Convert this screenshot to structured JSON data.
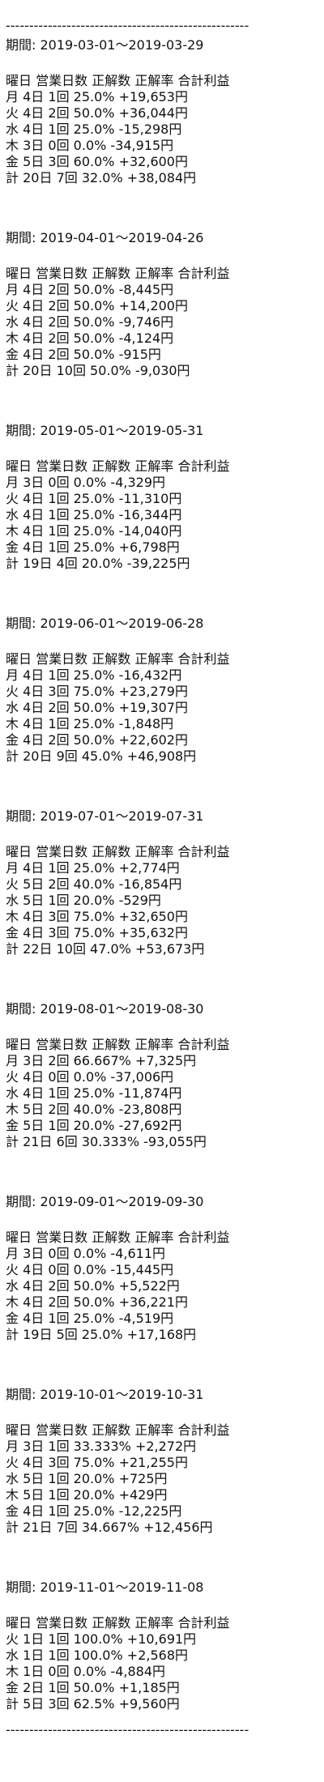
{
  "divider": "----------------------------------------------------",
  "period_label": "期間: ",
  "header": [
    "曜日",
    "営業日数",
    "正解数",
    "正解率",
    "合計利益"
  ],
  "periods": [
    {
      "range": "2019-03-01〜2019-03-29",
      "rows": [
        [
          "月",
          "4日",
          "1回",
          "25.0%",
          "+19,653円"
        ],
        [
          "火",
          "4日",
          "2回",
          "50.0%",
          "+36,044円"
        ],
        [
          "水",
          "4日",
          "1回",
          "25.0%",
          "-15,298円"
        ],
        [
          "木",
          "3日",
          "0回",
          "0.0%",
          "-34,915円"
        ],
        [
          "金",
          "5日",
          "3回",
          "60.0%",
          "+32,600円"
        ],
        [
          "計",
          "20日",
          "7回",
          "32.0%",
          "+38,084円"
        ]
      ]
    },
    {
      "range": "2019-04-01〜2019-04-26",
      "rows": [
        [
          "月",
          "4日",
          "2回",
          "50.0%",
          "-8,445円"
        ],
        [
          "火",
          "4日",
          "2回",
          "50.0%",
          "+14,200円"
        ],
        [
          "水",
          "4日",
          "2回",
          "50.0%",
          "-9,746円"
        ],
        [
          "木",
          "4日",
          "2回",
          "50.0%",
          "-4,124円"
        ],
        [
          "金",
          "4日",
          "2回",
          "50.0%",
          "-915円"
        ],
        [
          "計",
          "20日",
          "10回",
          "50.0%",
          "-9,030円"
        ]
      ]
    },
    {
      "range": "2019-05-01〜2019-05-31",
      "rows": [
        [
          "月",
          "3日",
          "0回",
          "0.0%",
          "-4,329円"
        ],
        [
          "火",
          "4日",
          "1回",
          "25.0%",
          "-11,310円"
        ],
        [
          "水",
          "4日",
          "1回",
          "25.0%",
          "-16,344円"
        ],
        [
          "木",
          "4日",
          "1回",
          "25.0%",
          "-14,040円"
        ],
        [
          "金",
          "4日",
          "1回",
          "25.0%",
          "+6,798円"
        ],
        [
          "計",
          "19日",
          "4回",
          "20.0%",
          "-39,225円"
        ]
      ]
    },
    {
      "range": "2019-06-01〜2019-06-28",
      "rows": [
        [
          "月",
          "4日",
          "1回",
          "25.0%",
          "-16,432円"
        ],
        [
          "火",
          "4日",
          "3回",
          "75.0%",
          "+23,279円"
        ],
        [
          "水",
          "4日",
          "2回",
          "50.0%",
          "+19,307円"
        ],
        [
          "木",
          "4日",
          "1回",
          "25.0%",
          "-1,848円"
        ],
        [
          "金",
          "4日",
          "2回",
          "50.0%",
          "+22,602円"
        ],
        [
          "計",
          "20日",
          "9回",
          "45.0%",
          "+46,908円"
        ]
      ]
    },
    {
      "range": "2019-07-01〜2019-07-31",
      "rows": [
        [
          "月",
          "4日",
          "1回",
          "25.0%",
          "+2,774円"
        ],
        [
          "火",
          "5日",
          "2回",
          "40.0%",
          "-16,854円"
        ],
        [
          "水",
          "5日",
          "1回",
          "20.0%",
          "-529円"
        ],
        [
          "木",
          "4日",
          "3回",
          "75.0%",
          "+32,650円"
        ],
        [
          "金",
          "4日",
          "3回",
          "75.0%",
          "+35,632円"
        ],
        [
          "計",
          "22日",
          "10回",
          "47.0%",
          "+53,673円"
        ]
      ]
    },
    {
      "range": "2019-08-01〜2019-08-30",
      "rows": [
        [
          "月",
          "3日",
          "2回",
          "66.667%",
          "+7,325円"
        ],
        [
          "火",
          "4日",
          "0回",
          "0.0%",
          "-37,006円"
        ],
        [
          "水",
          "4日",
          "1回",
          "25.0%",
          "-11,874円"
        ],
        [
          "木",
          "5日",
          "2回",
          "40.0%",
          "-23,808円"
        ],
        [
          "金",
          "5日",
          "1回",
          "20.0%",
          "-27,692円"
        ],
        [
          "計",
          "21日",
          "6回",
          "30.333%",
          "-93,055円"
        ]
      ]
    },
    {
      "range": "2019-09-01〜2019-09-30",
      "rows": [
        [
          "月",
          "3日",
          "0回",
          "0.0%",
          "-4,611円"
        ],
        [
          "火",
          "4日",
          "0回",
          "0.0%",
          "-15,445円"
        ],
        [
          "水",
          "4日",
          "2回",
          "50.0%",
          "+5,522円"
        ],
        [
          "木",
          "4日",
          "2回",
          "50.0%",
          "+36,221円"
        ],
        [
          "金",
          "4日",
          "1回",
          "25.0%",
          "-4,519円"
        ],
        [
          "計",
          "19日",
          "5回",
          "25.0%",
          "+17,168円"
        ]
      ]
    },
    {
      "range": "2019-10-01〜2019-10-31",
      "rows": [
        [
          "月",
          "3日",
          "1回",
          "33.333%",
          "+2,272円"
        ],
        [
          "火",
          "4日",
          "3回",
          "75.0%",
          "+21,255円"
        ],
        [
          "水",
          "5日",
          "1回",
          "20.0%",
          "+725円"
        ],
        [
          "木",
          "5日",
          "1回",
          "20.0%",
          "+429円"
        ],
        [
          "金",
          "4日",
          "1回",
          "25.0%",
          "-12,225円"
        ],
        [
          "計",
          "21日",
          "7回",
          "34.667%",
          "+12,456円"
        ]
      ]
    },
    {
      "range": "2019-11-01〜2019-11-08",
      "rows": [
        [
          "火",
          "1日",
          "1回",
          "100.0%",
          "+10,691円"
        ],
        [
          "水",
          "1日",
          "1回",
          "100.0%",
          "+2,568円"
        ],
        [
          "木",
          "1日",
          "0回",
          "0.0%",
          "-4,884円"
        ],
        [
          "金",
          "2日",
          "1回",
          "50.0%",
          "+1,185円"
        ],
        [
          "計",
          "5日",
          "3回",
          "62.5%",
          "+9,560円"
        ]
      ]
    }
  ]
}
